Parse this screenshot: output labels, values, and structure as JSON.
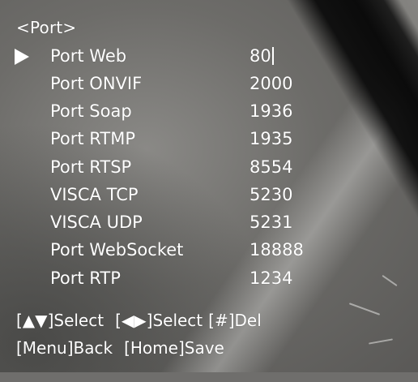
{
  "menu": {
    "title": "<Port>",
    "selected_index": 0,
    "items": [
      {
        "label": "Port Web",
        "value": "80"
      },
      {
        "label": "Port ONVIF",
        "value": "2000"
      },
      {
        "label": "Port Soap",
        "value": "1936"
      },
      {
        "label": "Port RTMP",
        "value": "1935"
      },
      {
        "label": "Port RTSP",
        "value": "8554"
      },
      {
        "label": "VISCA TCP",
        "value": "5230"
      },
      {
        "label": "VISCA UDP",
        "value": "5231"
      },
      {
        "label": "Port WebSocket",
        "value": "18888"
      },
      {
        "label": "Port RTP",
        "value": "1234"
      }
    ]
  },
  "hints": {
    "line1": {
      "updown_select": "[▲▼]Select",
      "leftright_select": "[◀▶]Select",
      "del": "[#]Del"
    },
    "line2": {
      "back": "[Menu]Back",
      "save": "[Home]Save"
    }
  },
  "colors": {
    "osd_text": "#ffffff"
  },
  "icons": {
    "cursor": "play-triangle-icon"
  }
}
